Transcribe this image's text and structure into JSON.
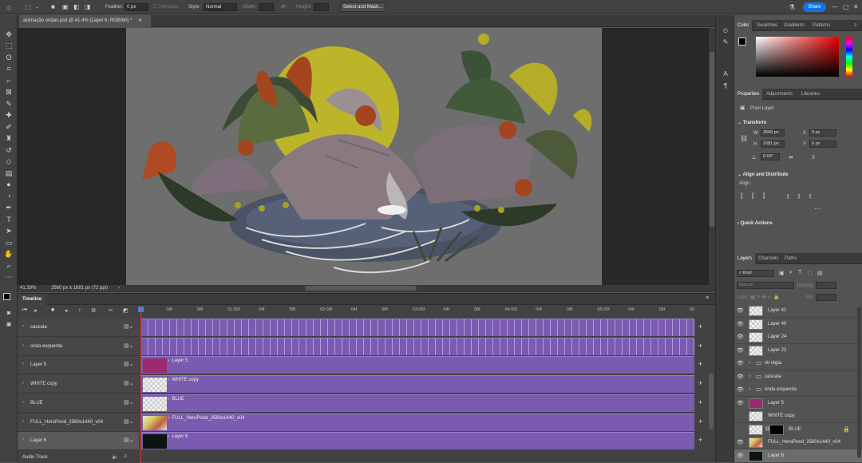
{
  "options_bar": {
    "feather_label": "Feather:",
    "feather_value": "0 px",
    "anti_alias_label": "Anti-alias",
    "style_label": "Style:",
    "style_value": "Normal",
    "width_label": "Width:",
    "height_label": "Height:",
    "select_mask_label": "Select and Mask...",
    "share_label": "Share"
  },
  "document": {
    "tab_title": "animação ondas.psd @ 41.4% (Layer 6, RGB/8#) *",
    "zoom": "41.39%",
    "doc_info": "2560 px x 1681 px (72 ppi)"
  },
  "color_panel": {
    "tabs": [
      "Color",
      "Swatches",
      "Gradients",
      "Patterns"
    ],
    "active_tab": "Color"
  },
  "properties_panel": {
    "tabs": [
      "Properties",
      "Adjustments",
      "Libraries"
    ],
    "pixel_layer_label": "Pixel Layer",
    "transform_label": "Transform",
    "w_label": "W",
    "w_value": "2560 px",
    "x_label": "X",
    "x_value": "0 px",
    "h_label": "H",
    "h_value": "1681 px",
    "y_label": "Y",
    "y_value": "0 px",
    "angle_value": "0.00°",
    "align_label": "Align and Distribute",
    "align_sub": "Align:",
    "quick_actions_label": "Quick Actions"
  },
  "layers_panel": {
    "tabs": [
      "Layers",
      "Channels",
      "Paths"
    ],
    "kind_label": "Kind",
    "blend_mode": "Normal",
    "opacity_label": "Opacity:",
    "lock_label": "Lock:",
    "fill_label": "Fill:",
    "layers": [
      {
        "name": "Layer 41",
        "type": "pixel"
      },
      {
        "name": "Layer 40",
        "type": "pixel"
      },
      {
        "name": "Layer 24",
        "type": "pixel"
      },
      {
        "name": "Layer 22",
        "type": "pixel"
      },
      {
        "name": "vit régia",
        "type": "group"
      },
      {
        "name": "cascata",
        "type": "group"
      },
      {
        "name": "onda esquerda",
        "type": "group"
      },
      {
        "name": "Layer 5",
        "type": "magenta"
      },
      {
        "name": "WHITE copy",
        "type": "pixel"
      },
      {
        "name": "BLUE",
        "type": "mask"
      },
      {
        "name": "FULL_HeroPond_2560x1440_v04",
        "type": "image"
      },
      {
        "name": "Layer 6",
        "type": "dark"
      }
    ]
  },
  "timeline": {
    "title": "Timeline",
    "ruler": [
      "04f",
      "08f",
      "01:00f",
      "04f",
      "08f",
      "02:00f",
      "04f",
      "08f",
      "03:00f",
      "04f",
      "08f",
      "04:00f",
      "04f",
      "08f",
      "05:00f",
      "04f",
      "08f",
      "06"
    ],
    "tracks": [
      {
        "name": "cascata",
        "clip": ""
      },
      {
        "name": "onda esquerda",
        "clip": ""
      },
      {
        "name": "Layer 5",
        "clip": "Layer 5"
      },
      {
        "name": "WHITE copy",
        "clip": "WHITE copy"
      },
      {
        "name": "BLUE",
        "clip": "BLUE"
      },
      {
        "name": "FULL_HeroPond_2560x1440_v04",
        "clip": "FULL_HeroPond_2560x1440_v04"
      },
      {
        "name": "Layer 6",
        "clip": "Layer 6"
      }
    ],
    "audio_track": "Audio Track"
  }
}
